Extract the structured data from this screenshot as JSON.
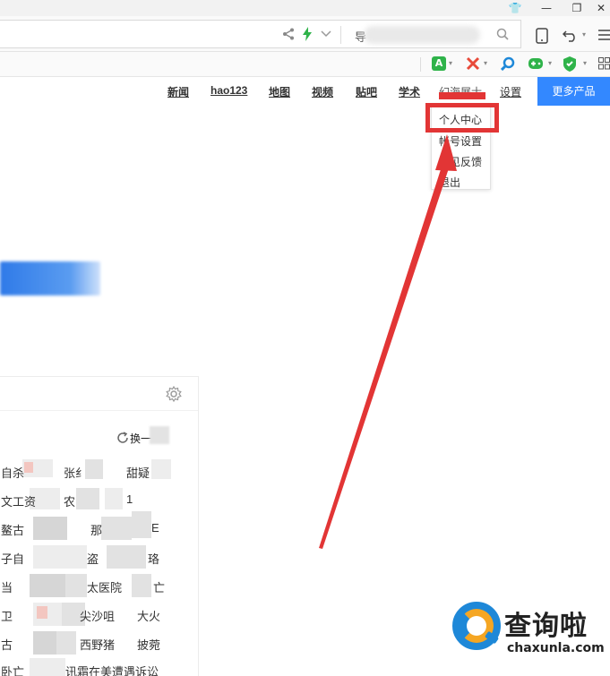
{
  "window": {
    "controls": {
      "skin": "👕",
      "minimize": "—",
      "restore": "❐",
      "close": "✕"
    }
  },
  "address_bar": {
    "visible_fragment": "导",
    "icons": [
      "share-icon",
      "lightning-icon",
      "chevron-down-icon",
      "search-icon"
    ]
  },
  "nav": {
    "links": [
      {
        "label": "新闻"
      },
      {
        "label": "hao123"
      },
      {
        "label": "地图"
      },
      {
        "label": "视频"
      },
      {
        "label": "贴吧"
      },
      {
        "label": "学术"
      }
    ],
    "user_name": "幻海展士",
    "settings": "设置",
    "more_products": "更多产品"
  },
  "user_menu": {
    "items": [
      {
        "label": "个人中心"
      },
      {
        "label": "帐号设置"
      },
      {
        "label": "意见反馈"
      },
      {
        "label": "退出"
      }
    ]
  },
  "hot_search": {
    "refresh_label": "换一",
    "rows": [
      [
        "自杀",
        "张纟",
        "甜疑"
      ],
      [
        "文工资",
        "农",
        "1"
      ],
      [
        "鳌古",
        "那",
        "E"
      ],
      [
        "子自",
        "盗",
        "珞"
      ],
      [
        "当",
        "太医院",
        "亡"
      ],
      [
        "卫",
        "尖沙咀",
        "大火"
      ],
      [
        "古",
        "西野猪",
        "披菀"
      ],
      [
        "卧亡",
        "讯霜在美遭遇诉讼"
      ]
    ]
  },
  "watermark": {
    "name_cn": "查询啦",
    "domain": "chaxunla.com"
  },
  "colors": {
    "accent_blue": "#3388ff",
    "annotation_red": "#e23535",
    "watermark_blue": "#1e88d8",
    "watermark_orange": "#f5a623"
  }
}
